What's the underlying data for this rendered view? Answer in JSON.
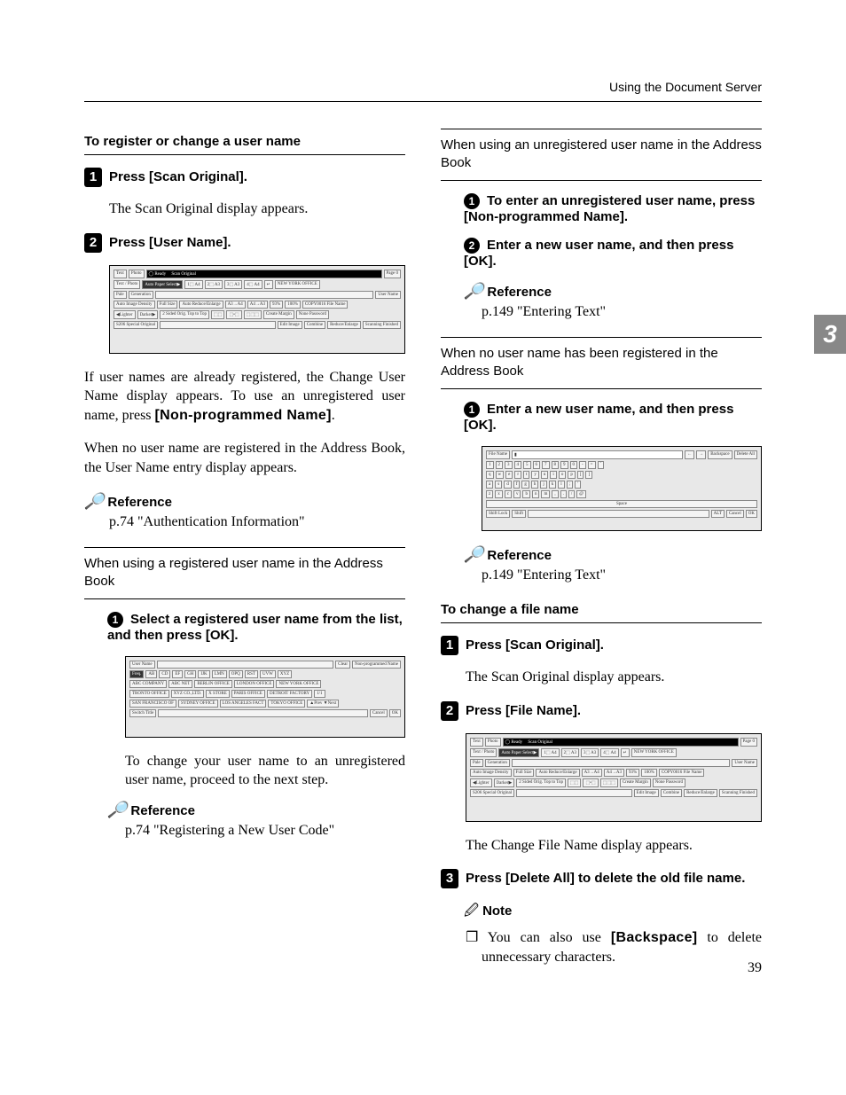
{
  "header": "Using the Document Server",
  "page_number": "39",
  "side_tab": "3",
  "left": {
    "section_title": "To register or change a user name",
    "step1_label": "Press ",
    "step1_bracket": "[Scan Original]",
    "step1_period": ".",
    "step1_body": "The Scan Original display appears.",
    "step2_label": "Press ",
    "step2_bracket": "[User Name]",
    "step2_period": ".",
    "para1": "If user names are already registered, the Change User Name display appears. To use an unregistered user name, press ",
    "para1_bold": "[Non-programmed Name]",
    "para1_period": ".",
    "para2": "When no user name are registered in the Address Book, the User Name entry display appears.",
    "ref_label": "Reference",
    "ref_body": "p.74 \"Authentication Information\"",
    "subhead1": "When using a registered user name in the Address Book",
    "sub1_step": "Select a registered user name from the list, and then press [OK].",
    "sub1_body": "To change your user name to an unregistered user name, proceed to the next step.",
    "sub1_ref_label": "Reference",
    "sub1_ref_body": "p.74 \"Registering a New User Code\""
  },
  "right": {
    "subhead2": "When using an unregistered user name in the Address Book",
    "sub2_step1": "To enter an unregistered user name, press [Non-programmed Name].",
    "sub2_step2": "Enter a new user name, and then press [OK].",
    "sub2_ref_label": "Reference",
    "sub2_ref_body": "p.149 \"Entering Text\"",
    "subhead3": "When no user name has been registered in the Address Book",
    "sub3_step1": "Enter a new user name, and then press [OK].",
    "sub3_ref_label": "Reference",
    "sub3_ref_body": "p.149 \"Entering Text\"",
    "section_title2": "To change a file name",
    "sec2_step1_label": "Press ",
    "sec2_step1_bracket": "[Scan Original]",
    "sec2_step1_period": ".",
    "sec2_step1_body": "The Scan Original display appears.",
    "sec2_step2_label": "Press ",
    "sec2_step2_bracket": "[File Name]",
    "sec2_step2_period": ".",
    "sec2_para": "The Change File Name display appears.",
    "sec2_step3_label": "Press ",
    "sec2_step3_bracket": "[Delete All]",
    "sec2_step3_rest": " to delete the old file name.",
    "note_label": "Note",
    "note_body_pre": "❐ You can also use ",
    "note_body_bold": "[Backspace]",
    "note_body_post": " to delete unnecessary characters."
  },
  "screenshots": {
    "scan_original": [
      "Text",
      "Photo",
      "Text / Photo",
      "Pale",
      "Generation",
      "Auto Image Density",
      "cLighter",
      "Darker>",
      "Ready",
      "Scan Original",
      "Auto Paper Select",
      "A4",
      "A3",
      "A3",
      "A4",
      "Full Size",
      "Auto Reduce / Enlarge",
      "A3→A4 A4→A5",
      "A4→A3 A5→A4",
      "9 3 %",
      "100%",
      "2 Sided Orig. Top to Top",
      "Create Margin",
      "Edit Image",
      "Combine",
      "Reduce / Enlarge",
      "Page 0",
      "NEW YORK OFFICE",
      "User Name",
      "COPY0016",
      "File Name",
      "None",
      "Password",
      "Scanning Finished",
      "S206 Special Original"
    ],
    "user_name_list": [
      "User Name",
      "Clear",
      "Non-programmed Name",
      "Freq.",
      "AB",
      "CD",
      "EF",
      "GH",
      "IJK",
      "LMN",
      "OPQ",
      "RST",
      "UVW",
      "XYZ",
      "ABC COMPANY",
      "ABC NET",
      "BERLIN OFFICE",
      "LONDON OFFICE",
      "NEW YORK OFFICE",
      "TRONTO OFFICE",
      "XYZ CO.,LTD.",
      "X STORE",
      "PARIS OFFICE",
      "DETROIT FACTORY",
      "SAN FRANCISCO OF",
      "SYDNEY OFFICE",
      "LOS ANGELES FACT",
      "TOKYO OFFICE",
      "1/1",
      "▲ Prev.",
      "▼ Next",
      "Switch Title",
      "Cancel",
      "OK"
    ],
    "keyboard": [
      "File Name",
      "←",
      "→",
      "Backspace",
      "Delete All",
      "1",
      "2",
      "3",
      "4",
      "5",
      "6",
      "7",
      "8",
      "9",
      "0",
      "-",
      "=",
      "`",
      "q",
      "w",
      "e",
      "r",
      "t",
      "y",
      "u",
      "i",
      "o",
      "p",
      "[",
      "]",
      "a",
      "s",
      "d",
      "f",
      "g",
      "h",
      "j",
      "k",
      "l",
      ";",
      "'",
      "z",
      "x",
      "c",
      "v",
      "b",
      "n",
      "m",
      ",",
      ".",
      "/",
      "@",
      "Space",
      "Shift Lock",
      "Shift",
      "-",
      "~",
      "_",
      "ALT",
      "Cancel",
      "OK"
    ]
  }
}
